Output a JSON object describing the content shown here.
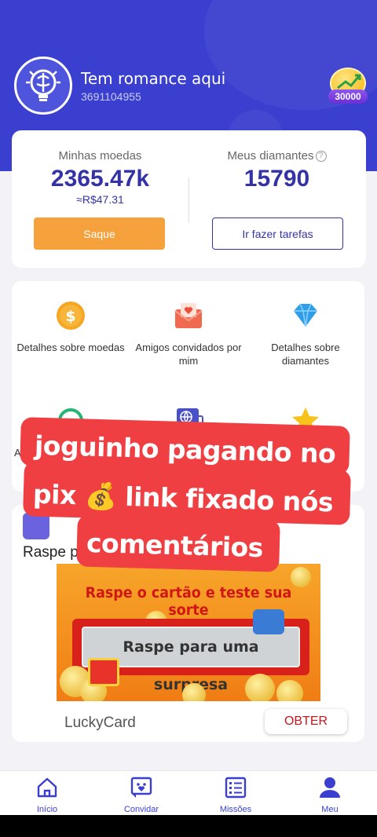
{
  "header": {
    "user_name": "Tem romance aqui",
    "user_id": "3691104955",
    "badge_value": "30000"
  },
  "wallet": {
    "coins_title": "Minhas moedas",
    "coins_value": "2365.47k",
    "coins_brl": "≈R$47.31",
    "diamonds_title": "Meus diamantes",
    "diamonds_value": "15790",
    "withdraw_label": "Saque",
    "tasks_label": "Ir fazer tarefas"
  },
  "menu": [
    {
      "label": "Detalhes sobre moedas",
      "icon": "dollar-coin-icon"
    },
    {
      "label": "Amigos convidados por mim",
      "icon": "envelope-heart-icon"
    },
    {
      "label": "Detalhes sobre diamantes",
      "icon": "diamond-icon"
    },
    {
      "label": "A",
      "icon": "headset-icon"
    },
    {
      "label": "",
      "icon": "globe-chat-icon"
    },
    {
      "label": "",
      "icon": "star-icon"
    }
  ],
  "raspe": {
    "title": "Raspe p",
    "banner_headline": "Raspe o cartão e teste sua sorte",
    "banner_scratch": "Raspe para uma surpresa",
    "card_name": "LuckyCard",
    "get_label": "OBTER"
  },
  "overlay": {
    "line1": "joguinho pagando no",
    "line2": "pix 💰 link fixado nós",
    "line3": "comentários"
  },
  "tabs": [
    {
      "label": "Início",
      "icon": "home-icon"
    },
    {
      "label": "Convidar",
      "icon": "invite-icon"
    },
    {
      "label": "Missões",
      "icon": "missions-icon"
    },
    {
      "label": "Meu",
      "icon": "profile-icon"
    }
  ],
  "colors": {
    "primary": "#3a3fcf",
    "accent_orange": "#f5a13c",
    "overlay_red": "#ef3f43",
    "obter_red": "#c8161d"
  }
}
